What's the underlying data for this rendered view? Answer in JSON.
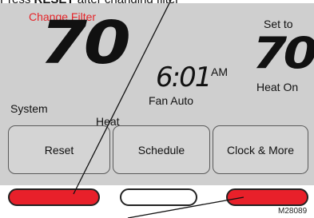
{
  "caption": {
    "prefix": "Press ",
    "bold_word": "RESET",
    "suffix": " after changing filter"
  },
  "display": {
    "alert": "Change Filter",
    "current_temp": "70",
    "time": "6:01",
    "time_ampm": "AM",
    "set_to_label": "Set to",
    "set_temp": "70",
    "heat_status": "Heat On",
    "system_label": "System",
    "system_value": "Heat",
    "fan_label": "Fan Auto"
  },
  "buttons": {
    "reset": "Reset",
    "schedule": "Schedule",
    "clock_more": "Clock & More"
  },
  "figure_id": "M28089",
  "colors": {
    "alert_text": "#e5252a",
    "highlight_button": "#e8202a",
    "screen_background": "#cfcfcf"
  }
}
